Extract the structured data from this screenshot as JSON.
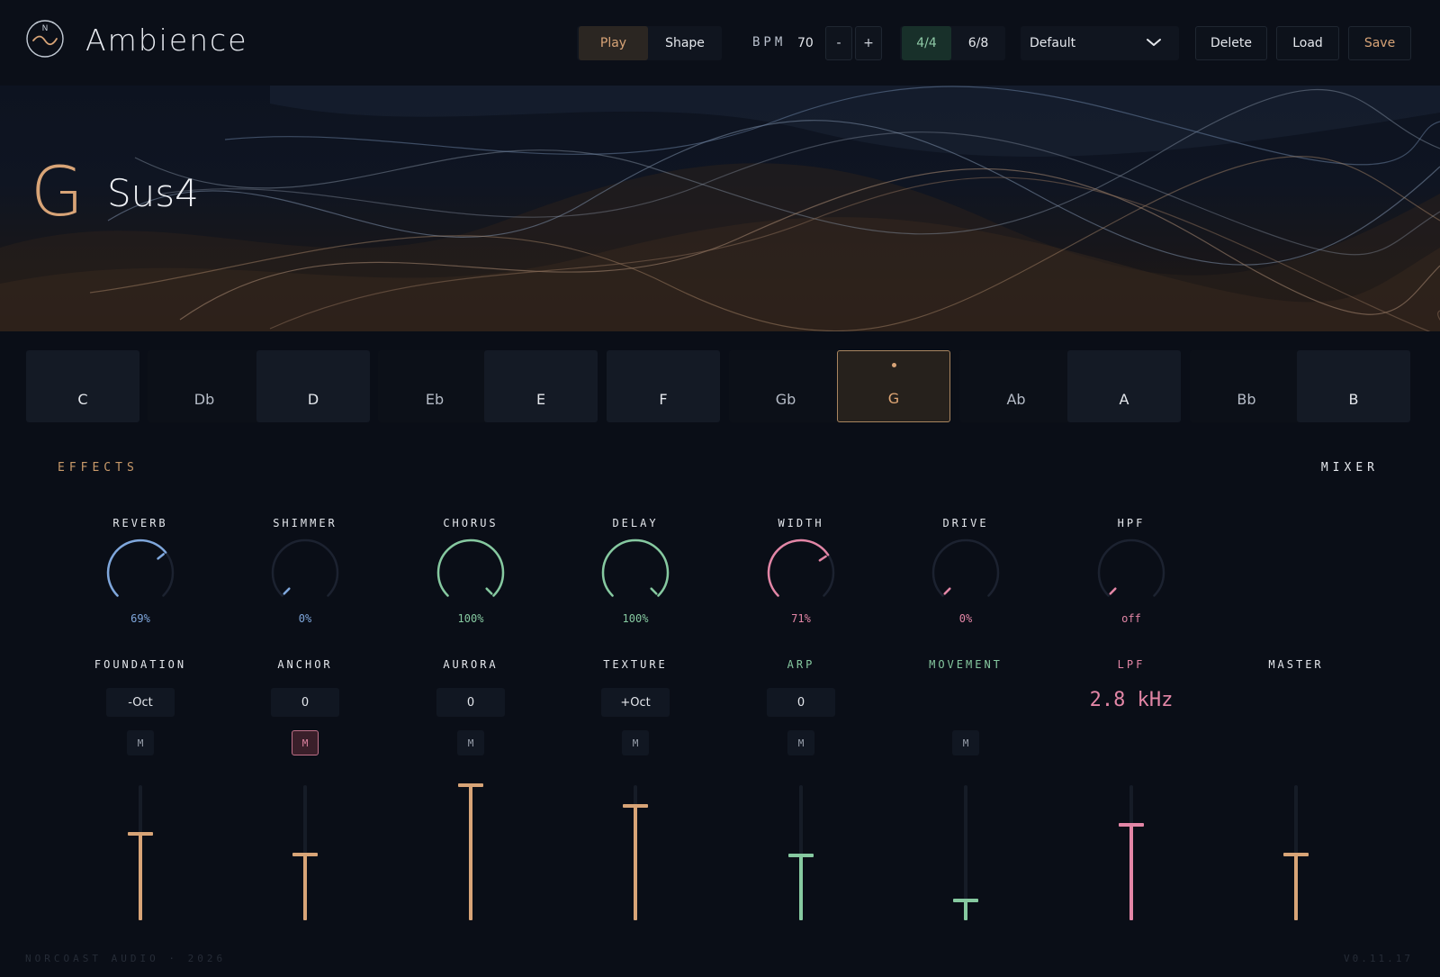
{
  "app": {
    "title": "Ambience",
    "logo_icon": "wave-circle-icon"
  },
  "toolbar": {
    "play_label": "Play",
    "shape_label": "Shape",
    "bpm_label": "BPM",
    "bpm_value": "70",
    "minus_label": "-",
    "plus_label": "+",
    "time_sig_44": "4/4",
    "time_sig_68": "6/8",
    "active_time_sig": "4/4",
    "preset_value": "Default",
    "delete_label": "Delete",
    "load_label": "Load",
    "save_label": "Save"
  },
  "hero": {
    "root": "G",
    "quality": "Sus4"
  },
  "keys": [
    {
      "label": "C",
      "type": "white"
    },
    {
      "label": "Db",
      "type": "black"
    },
    {
      "label": "D",
      "type": "white"
    },
    {
      "label": "Eb",
      "type": "black"
    },
    {
      "label": "E",
      "type": "white"
    },
    {
      "label": "F",
      "type": "white"
    },
    {
      "label": "Gb",
      "type": "black"
    },
    {
      "label": "G",
      "type": "active"
    },
    {
      "label": "Ab",
      "type": "black"
    },
    {
      "label": "A",
      "type": "white"
    },
    {
      "label": "Bb",
      "type": "black"
    },
    {
      "label": "B",
      "type": "white"
    }
  ],
  "sections": {
    "effects": "EFFECTS",
    "mixer": "MIXER"
  },
  "effects": [
    {
      "label": "REVERB",
      "value": "69%",
      "level": 0.69,
      "color": "#7fa7dc"
    },
    {
      "label": "SHIMMER",
      "value": "0%",
      "level": 0.0,
      "color": "#7fa7dc"
    },
    {
      "label": "CHORUS",
      "value": "100%",
      "level": 1.0,
      "color": "#86c9a0"
    },
    {
      "label": "DELAY",
      "value": "100%",
      "level": 1.0,
      "color": "#86c9a0"
    },
    {
      "label": "WIDTH",
      "value": "71%",
      "level": 0.71,
      "color": "#e386a6"
    },
    {
      "label": "DRIVE",
      "value": "0%",
      "level": 0.0,
      "color": "#e386a6"
    },
    {
      "label": "HPF",
      "value": "off",
      "level": 0.0,
      "color": "#e386a6"
    }
  ],
  "mixer": [
    {
      "label": "FOUNDATION",
      "field": "-Oct",
      "mute": "M",
      "mute_on": false,
      "level": 0.64,
      "color": "#d8a477",
      "label_color": "#e4e7ec"
    },
    {
      "label": "ANCHOR",
      "field": "0",
      "mute": "M",
      "mute_on": true,
      "level": 0.49,
      "color": "#d8a477",
      "label_color": "#e4e7ec"
    },
    {
      "label": "AURORA",
      "field": "0",
      "mute": "M",
      "mute_on": false,
      "level": 1.0,
      "color": "#d8a477",
      "label_color": "#e4e7ec"
    },
    {
      "label": "TEXTURE",
      "field": "+Oct",
      "mute": "M",
      "mute_on": false,
      "level": 0.85,
      "color": "#d8a477",
      "label_color": "#e4e7ec"
    },
    {
      "label": "ARP",
      "field": "0",
      "mute": "M",
      "mute_on": false,
      "level": 0.48,
      "color": "#86c9a0",
      "label_color": "#86c9a0"
    },
    {
      "label": "MOVEMENT",
      "mute": "M",
      "mute_on": false,
      "level": 0.15,
      "color": "#86c9a0",
      "label_color": "#86c9a0"
    },
    {
      "label": "LPF",
      "readout": "2.8 kHz",
      "level": 0.71,
      "color": "#e386a6",
      "label_color": "#e386a6"
    },
    {
      "label": "MASTER",
      "level": 0.49,
      "color": "#d8a477",
      "label_color": "#e4e7ec"
    }
  ],
  "footer": {
    "left": "NORCOAST AUDIO · 2026",
    "right": "V0.11.17"
  }
}
